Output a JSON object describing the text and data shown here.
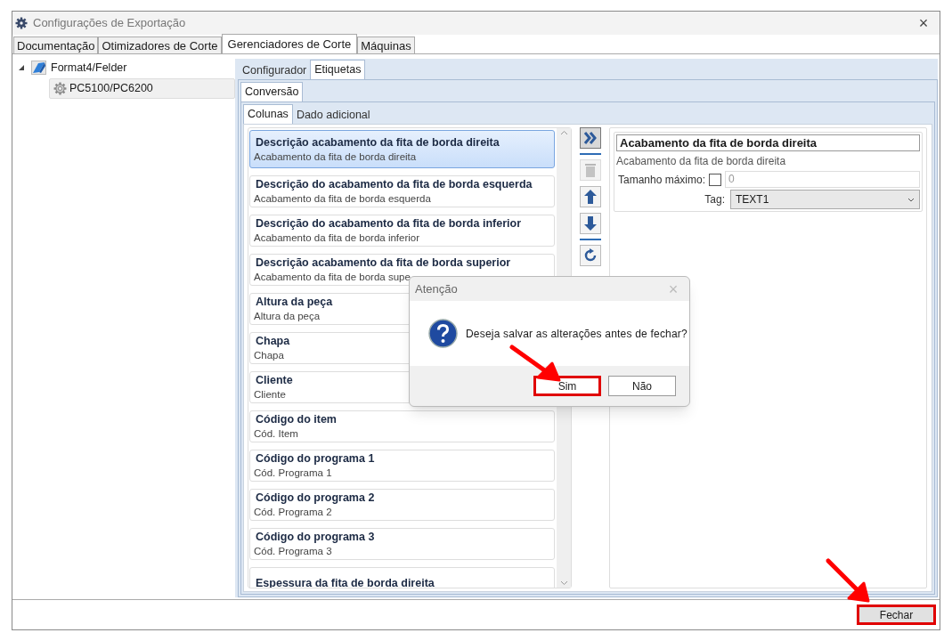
{
  "window": {
    "title": "Configurações de Exportação",
    "close": "×"
  },
  "tabs": [
    {
      "label": "Documentação",
      "selected": false
    },
    {
      "label": "Otimizadores de Corte",
      "selected": false
    },
    {
      "label": "Gerenciadores de Corte",
      "selected": true
    },
    {
      "label": "Máquinas",
      "selected": false
    }
  ],
  "tree": {
    "items": [
      {
        "label": "Format4/Felder",
        "expanded": true,
        "children": [
          {
            "label": "PC5100/PC6200",
            "selected": true
          }
        ]
      }
    ]
  },
  "sub_tabs": [
    {
      "label": "Configurador",
      "selected": false
    },
    {
      "label": "Etiquetas",
      "selected": true
    }
  ],
  "conversion_tabs": [
    {
      "label": "Conversão",
      "selected": true
    }
  ],
  "column_tabs": [
    {
      "label": "Colunas",
      "selected": true
    },
    {
      "label": "Dado adicional",
      "selected": false
    }
  ],
  "columns": [
    {
      "title": "Descrição acabamento da fita de borda direita",
      "subtitle": "Acabamento da fita de borda direita",
      "selected": true
    },
    {
      "title": "Descrição do acabamento da fita de borda esquerda",
      "subtitle": "Acabamento da fita de borda esquerda",
      "selected": false
    },
    {
      "title": "Descrição do acabamento da fita de borda inferior",
      "subtitle": "Acabamento da fita de borda inferior",
      "selected": false
    },
    {
      "title": "Descrição acabamento da fita de borda superior",
      "subtitle": "Acabamento da fita de borda supe",
      "selected": false
    },
    {
      "title": "Altura da peça",
      "subtitle": "Altura da peça",
      "selected": false
    },
    {
      "title": "Chapa",
      "subtitle": "Chapa",
      "selected": false
    },
    {
      "title": "Cliente",
      "subtitle": "Cliente",
      "selected": false
    },
    {
      "title": "Código do item",
      "subtitle": "Cód. Item",
      "selected": false
    },
    {
      "title": "Código do programa 1",
      "subtitle": "Cód. Programa 1",
      "selected": false
    },
    {
      "title": "Código do programa 2",
      "subtitle": "Cód. Programa 2",
      "selected": false
    },
    {
      "title": "Código do programa 3",
      "subtitle": "Cód. Programa 3",
      "selected": false
    },
    {
      "title": "Espessura da fita de borda direita",
      "selected": false
    }
  ],
  "tools": [
    {
      "kind": "add",
      "disabled": false
    },
    {
      "kind": "separator"
    },
    {
      "kind": "delete",
      "disabled": true
    },
    {
      "kind": "up",
      "disabled": false
    },
    {
      "kind": "down",
      "disabled": false
    },
    {
      "kind": "separator"
    },
    {
      "kind": "reset",
      "disabled": false
    }
  ],
  "details": {
    "name": "Acabamento da fita de borda direita",
    "description": "Acabamento da fita de borda direita",
    "max_size_label": "Tamanho máximo:",
    "max_size_checked": false,
    "max_size_value": "0",
    "tag_label": "Tag:",
    "tag_value": "TEXT1"
  },
  "dialog": {
    "title": "Atenção",
    "close": "×",
    "message": "Deseja salvar as alterações antes de fechar?",
    "buttons": [
      {
        "label": "Sim",
        "highlighted": true
      },
      {
        "label": "Não",
        "highlighted": false
      }
    ]
  },
  "footer": {
    "button": {
      "label": "Fechar",
      "highlighted": true
    }
  }
}
